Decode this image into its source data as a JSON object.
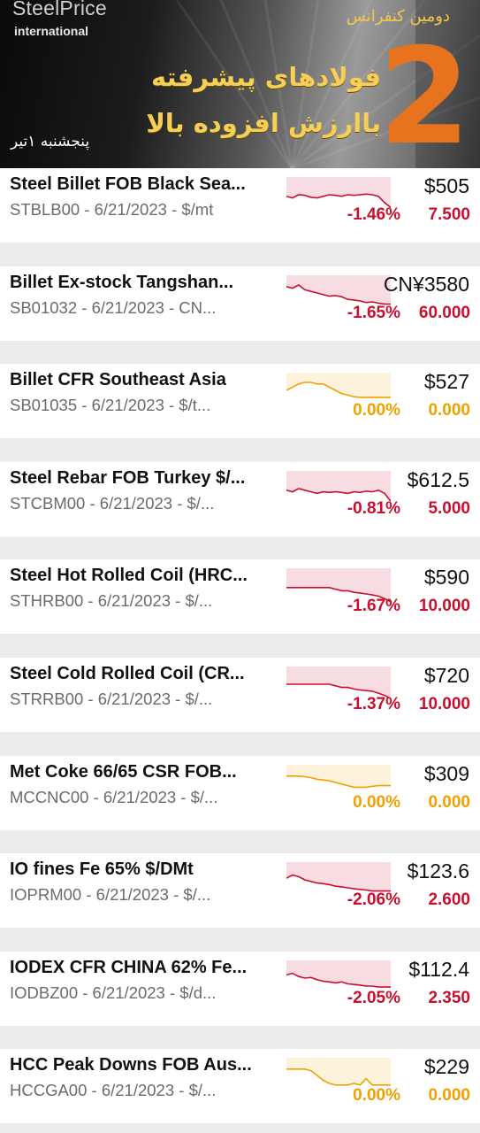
{
  "banner": {
    "brand": "SteelPrice",
    "brand_sub": "international",
    "conference": "دومین کنفرانس",
    "title_line1": "فولادهای پیشرفته",
    "title_line2": "باارزش افزوده بالا",
    "number": "2",
    "date": "پنجشنبه ۱تیر"
  },
  "colors": {
    "negative": "#c8102e",
    "flat": "#f0a100"
  },
  "items": [
    {
      "name": "Steel Billet FOB Black Sea...",
      "subtitle": "STBLB00 - 6/21/2023 - $/mt",
      "price": "$505",
      "pct": "-1.46%",
      "change": "7.500",
      "trend": "negative",
      "spark": [
        0.55,
        0.6,
        0.5,
        0.52,
        0.58,
        0.6,
        0.55,
        0.5,
        0.52,
        0.55,
        0.5,
        0.52,
        0.5,
        0.48,
        0.5,
        0.55,
        0.75,
        0.9
      ]
    },
    {
      "name": "Billet Ex-stock Tangshan...",
      "subtitle": "SB01032 - 6/21/2023 - CN...",
      "price": "CN¥3580",
      "pct": "-1.65%",
      "change": "60.000",
      "trend": "negative",
      "spark": [
        0.3,
        0.35,
        0.25,
        0.4,
        0.45,
        0.5,
        0.55,
        0.6,
        0.58,
        0.62,
        0.7,
        0.72,
        0.75,
        0.8,
        0.78,
        0.82,
        0.85,
        0.85
      ]
    },
    {
      "name": "Billet CFR Southeast Asia",
      "subtitle": "SB01035 - 6/21/2023 - $/t...",
      "price": "$527",
      "pct": "0.00%",
      "change": "0.000",
      "trend": "flat",
      "spark": [
        0.5,
        0.4,
        0.3,
        0.25,
        0.25,
        0.3,
        0.3,
        0.4,
        0.5,
        0.6,
        0.65,
        0.7,
        0.72,
        0.72,
        0.72,
        0.72,
        0.72,
        0.72
      ]
    },
    {
      "name": "Steel Rebar FOB Turkey $/...",
      "subtitle": "STCBM00 - 6/21/2023 - $/...",
      "price": "$612.5",
      "pct": "-0.81%",
      "change": "5.000",
      "trend": "negative",
      "spark": [
        0.55,
        0.6,
        0.5,
        0.55,
        0.6,
        0.65,
        0.6,
        0.62,
        0.6,
        0.62,
        0.65,
        0.6,
        0.62,
        0.58,
        0.6,
        0.55,
        0.65,
        0.9
      ]
    },
    {
      "name": "Steel Hot Rolled Coil (HRC...",
      "subtitle": "STHRB00 - 6/21/2023 - $/...",
      "price": "$590",
      "pct": "-1.67%",
      "change": "10.000",
      "trend": "negative",
      "spark": [
        0.55,
        0.55,
        0.55,
        0.55,
        0.55,
        0.55,
        0.55,
        0.55,
        0.6,
        0.65,
        0.65,
        0.7,
        0.72,
        0.75,
        0.78,
        0.82,
        0.9,
        1.0
      ]
    },
    {
      "name": "Steel Cold Rolled Coil (CR...",
      "subtitle": "STRRB00 - 6/21/2023 - $/...",
      "price": "$720",
      "pct": "-1.37%",
      "change": "10.000",
      "trend": "negative",
      "spark": [
        0.5,
        0.5,
        0.5,
        0.5,
        0.5,
        0.5,
        0.5,
        0.5,
        0.55,
        0.6,
        0.6,
        0.65,
        0.68,
        0.7,
        0.72,
        0.78,
        0.85,
        0.95
      ]
    },
    {
      "name": "Met Coke 66/65 CSR FOB...",
      "subtitle": "MCCNC00 - 6/21/2023 - $/...",
      "price": "$309",
      "pct": "0.00%",
      "change": "0.000",
      "trend": "flat",
      "spark": [
        0.3,
        0.3,
        0.3,
        0.32,
        0.35,
        0.4,
        0.42,
        0.45,
        0.5,
        0.55,
        0.6,
        0.65,
        0.65,
        0.65,
        0.62,
        0.6,
        0.6,
        0.6
      ]
    },
    {
      "name": "IO fines Fe 65% $/DMt",
      "subtitle": "IOPRM00 - 6/21/2023 - $/...",
      "price": "$123.6",
      "pct": "-2.06%",
      "change": "2.600",
      "trend": "negative",
      "spark": [
        0.45,
        0.35,
        0.4,
        0.5,
        0.55,
        0.6,
        0.62,
        0.65,
        0.7,
        0.72,
        0.75,
        0.78,
        0.8,
        0.82,
        0.85,
        0.85,
        0.85,
        0.85
      ]
    },
    {
      "name": "IODEX CFR CHINA 62% Fe...",
      "subtitle": "IODBZ00 - 6/21/2023 - $/d...",
      "price": "$112.4",
      "pct": "-2.05%",
      "change": "2.350",
      "trend": "negative",
      "spark": [
        0.4,
        0.35,
        0.45,
        0.5,
        0.48,
        0.55,
        0.6,
        0.62,
        0.65,
        0.62,
        0.68,
        0.7,
        0.72,
        0.75,
        0.75,
        0.78,
        0.78,
        0.78
      ]
    },
    {
      "name": "HCC Peak Downs FOB Aus...",
      "subtitle": "HCCGA00 - 6/21/2023 - $/...",
      "price": "$229",
      "pct": "0.00%",
      "change": "0.000",
      "trend": "flat",
      "spark": [
        0.3,
        0.3,
        0.3,
        0.3,
        0.35,
        0.5,
        0.65,
        0.75,
        0.8,
        0.8,
        0.8,
        0.75,
        0.8,
        0.6,
        0.8,
        0.8,
        0.8,
        0.8
      ]
    }
  ]
}
